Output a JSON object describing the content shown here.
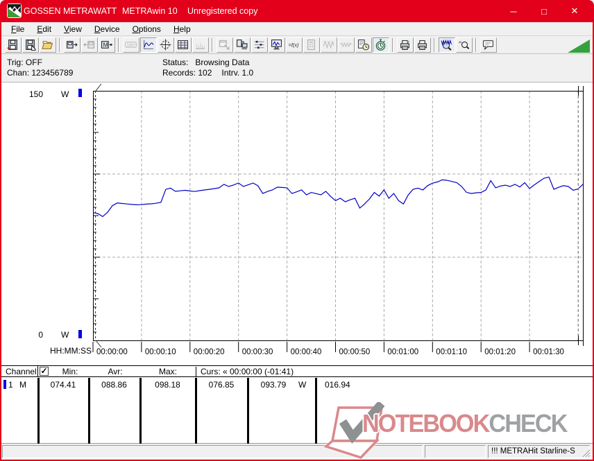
{
  "window": {
    "brand": "GOSSEN METRAWATT",
    "app": "METRAwin 10",
    "license": "Unregistered copy",
    "minimize_glyph": "─",
    "maximize_glyph": "□",
    "close_glyph": "✕"
  },
  "menu": {
    "items": [
      "File",
      "Edit",
      "View",
      "Device",
      "Options",
      "Help"
    ]
  },
  "toolbar": {
    "buttons": [
      {
        "name": "save",
        "state": "normal"
      },
      {
        "name": "save-as",
        "state": "normal"
      },
      {
        "name": "open",
        "state": "normal"
      },
      {
        "sep": true
      },
      {
        "name": "device-export",
        "state": "normal"
      },
      {
        "name": "device-import",
        "state": "disabled"
      },
      {
        "name": "memory-read",
        "state": "normal"
      },
      {
        "sep": true
      },
      {
        "name": "lcd-display",
        "state": "disabled"
      },
      {
        "name": "graph-view",
        "state": "pressed"
      },
      {
        "name": "scope-view",
        "state": "normal"
      },
      {
        "name": "table-view",
        "state": "normal"
      },
      {
        "name": "bargraph-view",
        "state": "disabled"
      },
      {
        "sep": true
      },
      {
        "name": "new-window",
        "state": "disabled"
      },
      {
        "name": "record-data",
        "state": "normal"
      },
      {
        "name": "channel-setup",
        "state": "normal"
      },
      {
        "name": "pc-display",
        "state": "normal"
      },
      {
        "name": "formula",
        "state": "normal"
      },
      {
        "name": "calc-channel",
        "state": "disabled"
      },
      {
        "name": "wave-clip",
        "state": "disabled"
      },
      {
        "name": "wave-rms",
        "state": "disabled"
      },
      {
        "name": "time-record",
        "state": "normal"
      },
      {
        "name": "stopwatch",
        "state": "pressed"
      },
      {
        "sep": true
      },
      {
        "name": "print-preview",
        "state": "normal"
      },
      {
        "name": "print",
        "state": "normal"
      },
      {
        "sep": true
      },
      {
        "name": "zoom-time",
        "state": "pressed"
      },
      {
        "name": "zoom-out",
        "state": "normal"
      },
      {
        "sep": true
      },
      {
        "name": "annotation",
        "state": "normal"
      }
    ]
  },
  "status_panel": {
    "trig_label": "Trig:",
    "trig_value": "OFF",
    "chan_label": "Chan:",
    "chan_value": "123456789",
    "status_label": "Status:",
    "status_value": "Browsing Data",
    "records_label": "Records:",
    "records_value": "102",
    "intrv_label": "Intrv.",
    "intrv_value": "1.0"
  },
  "chart_data": {
    "type": "line",
    "title": "",
    "ylabel": "W",
    "y_axis": {
      "top_label": "150",
      "bottom_label": "0",
      "unit_label": "W",
      "min": 0,
      "max": 150,
      "gridlines": [
        50,
        100
      ],
      "minor_tick_step": 5
    },
    "x_axis": {
      "label": "HH:MM:SS",
      "tick_labels": [
        "00:00:00",
        "00:00:10",
        "00:00:20",
        "00:00:30",
        "00:00:40",
        "00:00:50",
        "00:01:00",
        "00:01:10",
        "00:01:20",
        "00:01:30"
      ],
      "tick_interval_s": 10,
      "total_seconds": 101
    },
    "cursors": {
      "cursor1_time": "00:00:00",
      "cursor2_offset": "-01:41"
    },
    "grid": true,
    "legend": false,
    "series": [
      {
        "name": "Channel 1 Power",
        "unit": "W",
        "color": "#0000c8",
        "interval_s": 1,
        "values": [
          76.8,
          76.2,
          74.41,
          77.0,
          81.0,
          82.6,
          82.3,
          82.0,
          81.7,
          81.5,
          81.6,
          81.9,
          82.1,
          82.4,
          83.0,
          90.8,
          91.5,
          89.6,
          89.9,
          90.2,
          89.8,
          89.5,
          90.0,
          90.4,
          90.8,
          91.2,
          91.7,
          93.8,
          92.5,
          93.4,
          94.6,
          92.5,
          93.5,
          94.6,
          92.9,
          88.3,
          89.5,
          90.4,
          92.1,
          91.9,
          91.7,
          88.3,
          89.3,
          90.4,
          87.5,
          88.9,
          88.2,
          87.5,
          89.6,
          86.5,
          84.0,
          85.4,
          83.3,
          84.5,
          85.4,
          79.5,
          82.0,
          85.0,
          88.9,
          86.7,
          90.4,
          85.4,
          88.3,
          84.0,
          82.0,
          87.5,
          90.8,
          91.5,
          90.4,
          93.0,
          94.5,
          95.2,
          96.5,
          96.2,
          95.5,
          94.8,
          92.5,
          89.0,
          88.3,
          88.7,
          88.9,
          90.4,
          96.0,
          91.7,
          92.8,
          93.3,
          92.5,
          93.8,
          92.2,
          94.8,
          91.3,
          93.5,
          95.5,
          97.5,
          98.18,
          90.8,
          92.0,
          93.0,
          92.5,
          90.2,
          91.0,
          93.79
        ]
      }
    ]
  },
  "table": {
    "header": {
      "channel": "Channel:",
      "checkbox_checked": true,
      "check_glyph": "✓",
      "min": "Min:",
      "avr": "Avr:",
      "max": "Max:",
      "curs": "Curs: « 00:00:00 (-01:41)"
    },
    "row": {
      "marker_color": "#0000e8",
      "num": "1",
      "mode": "M",
      "min": "074.41",
      "avr": "088.86",
      "max": "098.18",
      "curs1": "076.85",
      "curs2": "093.79",
      "unit": "W",
      "delta": "016.94"
    }
  },
  "watermark": {
    "word1": "NOTEBOOK",
    "word2": "CHECK"
  },
  "statusbar": {
    "device": "!!! METRAHit Starline-S"
  },
  "colors": {
    "accent_red": "#e2001a",
    "chart_line": "#0000c8",
    "marker_blue": "#0000e8",
    "triangle_green": "#35a13c",
    "watermark_pink": "#d9898c",
    "watermark_gray": "#9fa1a3"
  }
}
